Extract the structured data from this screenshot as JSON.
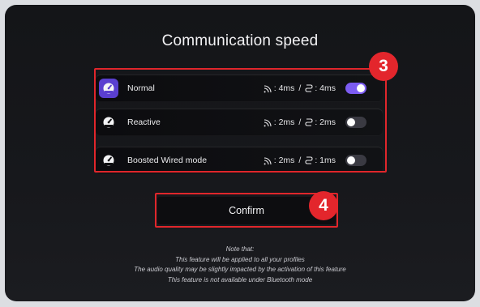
{
  "title": "Communication speed",
  "options": [
    {
      "label": "Normal",
      "wireless": ": 4ms",
      "wired": ": 4ms",
      "separator": "/",
      "enabled": true
    },
    {
      "label": "Reactive",
      "wireless": ": 2ms",
      "wired": ": 2ms",
      "separator": "/",
      "enabled": false
    },
    {
      "label": "Boosted Wired mode",
      "wireless": ": 2ms",
      "wired": ": 1ms",
      "separator": "/",
      "enabled": false
    }
  ],
  "annotations": {
    "options_badge": "3",
    "confirm_badge": "4"
  },
  "confirm_label": "Confirm",
  "notes": [
    "Note that:",
    "This feature will be applied to all your profiles",
    "The audio quality may be slightly impacted by the activation of this feature",
    "This feature is not available under Bluetooth mode"
  ],
  "colors": {
    "accent": "#7c5cf2",
    "highlight": "#e0262b",
    "icon_active": "#5a3fd0"
  },
  "icons": {
    "option": "speedometer-icon",
    "wireless": "wireless-icon",
    "wired": "wired-icon"
  }
}
